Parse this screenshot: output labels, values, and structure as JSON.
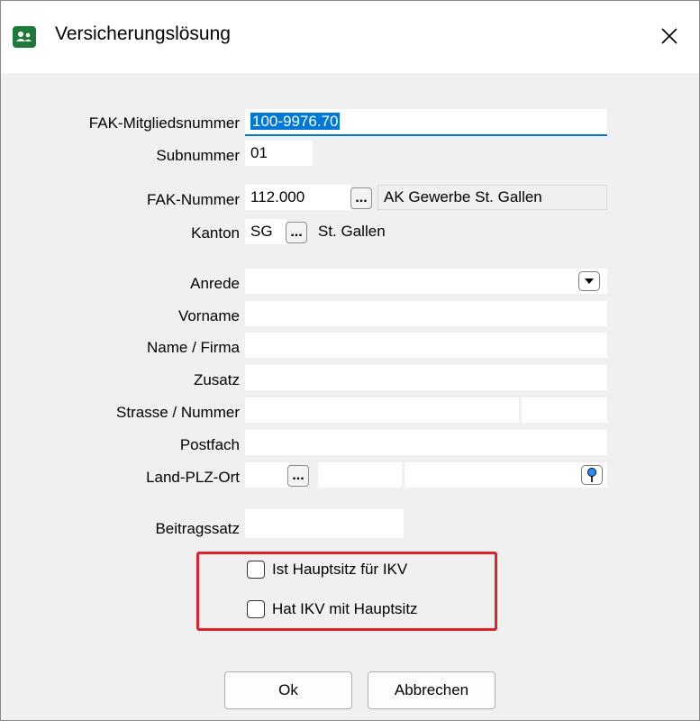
{
  "window": {
    "title": "Versicherungslösung",
    "app_icon": "people-icon",
    "close_icon": "close-icon"
  },
  "form": {
    "fak_mitgliedsnummer": {
      "label": "FAK-Mitgliedsnummer",
      "value": "100-9976.70"
    },
    "subnummer": {
      "label": "Subnummer",
      "value": "01"
    },
    "fak_nummer": {
      "label": "FAK-Nummer",
      "value": "112.000",
      "description": "AK Gewerbe St. Gallen",
      "lookup": "..."
    },
    "kanton": {
      "label": "Kanton",
      "value": "SG",
      "description": "St. Gallen",
      "lookup": "..."
    },
    "anrede": {
      "label": "Anrede",
      "value": ""
    },
    "vorname": {
      "label": "Vorname",
      "value": ""
    },
    "name_firma": {
      "label": "Name / Firma",
      "value": ""
    },
    "zusatz": {
      "label": "Zusatz",
      "value": ""
    },
    "strasse_nummer": {
      "label": "Strasse / Nummer",
      "street": "",
      "number": ""
    },
    "postfach": {
      "label": "Postfach",
      "value": ""
    },
    "land_plz_ort": {
      "label": "Land-PLZ-Ort",
      "land": "",
      "plz": "",
      "ort": "",
      "lookup": "..."
    },
    "beitragssatz": {
      "label": "Beitragssatz",
      "value": ""
    }
  },
  "checkboxes": {
    "ist_hauptsitz": {
      "label": "Ist Hauptsitz für IKV",
      "checked": false
    },
    "hat_ikv": {
      "label": "Hat IKV mit Hauptsitz",
      "checked": false
    }
  },
  "buttons": {
    "ok": "Ok",
    "cancel": "Abbrechen"
  },
  "colors": {
    "selection": "#0078d7",
    "highlight_border": "#e0202a",
    "app_icon": "#1f7a3a"
  }
}
